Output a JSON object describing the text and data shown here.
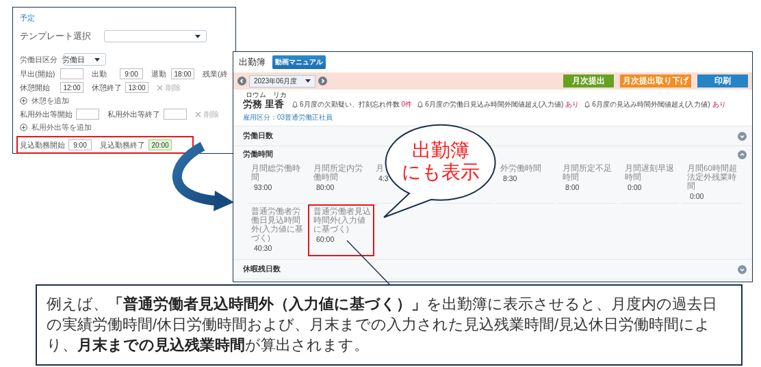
{
  "schedule_panel": {
    "title": "予定",
    "template": {
      "label": "テンプレート選択"
    },
    "workday_type": {
      "label": "労働日区分",
      "value": "労働日"
    },
    "rows": [
      {
        "kind": "times",
        "emphasized": false,
        "fields": [
          {
            "label": "早出(開始)",
            "highlighted": false
          },
          {
            "label": "出勤",
            "value": "9:00",
            "highlighted": false
          },
          {
            "label": "退勤",
            "value": "18:00",
            "highlighted": false
          }
        ],
        "trailing_label": "残業(終"
      },
      {
        "kind": "times",
        "emphasized": false,
        "fields": [
          {
            "label": "休憩開始",
            "value": "12:00",
            "highlighted": false
          },
          {
            "label": "休憩終了",
            "value": "13:00",
            "highlighted": false
          }
        ],
        "delete": "削除"
      },
      {
        "kind": "add",
        "emphasized": false,
        "label": "休憩を追加"
      },
      {
        "kind": "times",
        "emphasized": false,
        "fields": [
          {
            "label": "私用外出等開始",
            "highlighted": false
          },
          {
            "label": "私用外出等終了",
            "highlighted": false
          }
        ],
        "delete": "削除"
      },
      {
        "kind": "add",
        "emphasized": false,
        "label": "私用外出等を追加"
      },
      {
        "kind": "times",
        "emphasized": true,
        "fields": [
          {
            "label": "見込勤務開始",
            "value": "9:00",
            "highlighted": false
          },
          {
            "label": "見込勤務終了",
            "value": "20:00",
            "highlighted": true
          }
        ]
      }
    ]
  },
  "attendance_panel": {
    "title": "出勤簿",
    "manual_button": "動画マニュアル",
    "period": "2023年06月度",
    "actions": [
      {
        "label": "月次提出",
        "color": "#66a123"
      },
      {
        "label": "月次提出取り下げ",
        "color": "#ef8f25"
      },
      {
        "label": "印刷",
        "color": "#2585c4"
      }
    ],
    "employee": {
      "furigana_family": "ロウム",
      "furigana_given": "リカ",
      "name": "労務 里香"
    },
    "notices": [
      {
        "text": "6月度の欠勤疑い、打刻忘れ件数",
        "value": "0件"
      },
      {
        "text": "6月度の労働日見込み時間外閾値超え(入力値)",
        "value": "あり"
      },
      {
        "text": "6月度の見込み時間外閾値超え(入力値)",
        "value": "あり"
      }
    ],
    "employment": "雇用区分：03普通労働正社員",
    "sections": [
      {
        "title": "労働日数",
        "expanded": false
      },
      {
        "title": "労働時間",
        "expanded": true,
        "stats": [
          {
            "label": "月間総労働時間",
            "value": "93:00",
            "emphasized": false
          },
          {
            "label": "月間所定内労働時間",
            "value": "80:00",
            "emphasized": false
          },
          {
            "label": "月",
            "value": "4:3",
            "emphasized": false
          },
          {
            "label": "外労働時間",
            "value": "8:30",
            "emphasized": false
          },
          {
            "label": "月間所定不足時間",
            "value": "8:00",
            "emphasized": false
          },
          {
            "label": "月間遅刻早退時間",
            "value": "0:00",
            "emphasized": false
          },
          {
            "label": "月間60時間超法定外残業時間",
            "value": "0:00",
            "emphasized": false
          },
          {
            "label": "普通労働者労働日見込時間外(入力値に基づく)",
            "value": "40:30",
            "emphasized": false
          },
          {
            "label": "普通労働者見込時間外(入力値に基づく)",
            "value": "60:00",
            "emphasized": true
          }
        ]
      },
      {
        "title": "休暇残日数",
        "expanded": false
      }
    ]
  },
  "speech_bubble": {
    "lines": [
      "出勤簿",
      "にも表示"
    ]
  },
  "note": {
    "text": "例えば、**「普通労働者見込時間外（入力値に基づく）」**を出勤簿に表示させると、月度内の過去日の実績労働時間/休日労働時間および、月末までの入力された見込残業時間/見込休日労働時間により、**月末までの見込残業時間**が算出されます。"
  }
}
